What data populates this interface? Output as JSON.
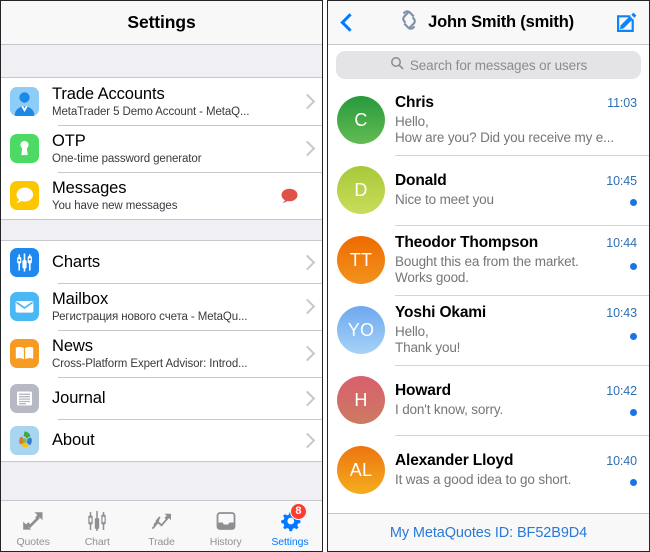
{
  "settings_panel": {
    "nav": {
      "title": "Settings"
    },
    "groups": [
      {
        "items": [
          {
            "icon": "person-account-icon",
            "title": "Trade Accounts",
            "subtitle": "MetaTrader 5 Demo Account - MetaQ...",
            "accessory": "chevron"
          },
          {
            "icon": "keyhole-lock-icon",
            "title": "OTP",
            "subtitle": "One-time password generator",
            "accessory": "chevron"
          },
          {
            "icon": "speech-bubble-icon",
            "title": "Messages",
            "subtitle": "You have new messages",
            "accessory": "message-badge"
          }
        ]
      },
      {
        "items": [
          {
            "icon": "candlestick-chart-icon",
            "title": "Charts",
            "subtitle": "",
            "accessory": "chevron"
          },
          {
            "icon": "envelope-mail-icon",
            "title": "Mailbox",
            "subtitle": "Регистрация нового счета - MetaQu...",
            "accessory": "chevron"
          },
          {
            "icon": "open-book-news-icon",
            "title": "News",
            "subtitle": "Cross-Platform Expert Advisor: Introd...",
            "accessory": "chevron"
          },
          {
            "icon": "journal-lines-icon",
            "title": "Journal",
            "subtitle": "",
            "accessory": "chevron"
          },
          {
            "icon": "metaquotes-about-icon",
            "title": "About",
            "subtitle": "",
            "accessory": "chevron"
          }
        ]
      }
    ],
    "tab_bar": {
      "active_index": 4,
      "tabs": [
        {
          "icon": "quotes-arrows-icon",
          "label": "Quotes",
          "badge": ""
        },
        {
          "icon": "candlestick-icon",
          "label": "Chart",
          "badge": ""
        },
        {
          "icon": "trade-trend-icon",
          "label": "Trade",
          "badge": ""
        },
        {
          "icon": "history-tray-icon",
          "label": "History",
          "badge": ""
        },
        {
          "icon": "gear-settings-icon",
          "label": "Settings",
          "badge": "8"
        }
      ]
    }
  },
  "chat_panel": {
    "nav": {
      "back_icon": "back-chevron-icon",
      "logo_icon": "metaquotes-logo-icon",
      "title": "John Smith (smith)",
      "compose_icon": "compose-pencil-icon"
    },
    "search": {
      "icon": "search-icon",
      "placeholder": "Search for messages or users",
      "value": ""
    },
    "conversations": [
      {
        "initials": "C",
        "avatar_from": "#279a3c",
        "avatar_to": "#63bb52",
        "name": "Chris",
        "time": "11:03",
        "lines": [
          "Hello,",
          "How are you? Did you receive my e..."
        ],
        "unread": false
      },
      {
        "initials": "D",
        "avatar_from": "#a8c93a",
        "avatar_to": "#c4d84f",
        "name": "Donald",
        "time": "10:45",
        "lines": [
          "Nice to meet you"
        ],
        "unread": true
      },
      {
        "initials": "TT",
        "avatar_from": "#f07000",
        "avatar_to": "#ef8a1a",
        "name": "Theodor Thompson",
        "time": "10:44",
        "lines": [
          "Bought this ea from the market.",
          "Works good."
        ],
        "unread": true
      },
      {
        "initials": "YO",
        "avatar_from": "#6ea8ef",
        "avatar_to": "#9fcdf5",
        "name": "Yoshi Okami",
        "time": "10:43",
        "lines": [
          "Hello,",
          "Thank you!"
        ],
        "unread": true
      },
      {
        "initials": "H",
        "avatar_from": "#d8606e",
        "avatar_to": "#cf7168",
        "name": "Howard",
        "time": "10:42",
        "lines": [
          "I don't know, sorry."
        ],
        "unread": true
      },
      {
        "initials": "AL",
        "avatar_from": "#ef7d12",
        "avatar_to": "#f2a41c",
        "name": "Alexander Lloyd",
        "time": "10:40",
        "lines": [
          "It was a good idea to go short."
        ],
        "unread": true
      }
    ],
    "footer": {
      "link_label": "My MetaQuotes ID: BF52B9D4"
    }
  },
  "colors": {
    "accent_blue": "#007aff",
    "badge_red": "#ff3b30",
    "unread_blue": "#1a73e8",
    "time_blue": "#2e6fb0",
    "group_bg": "#efeff4"
  }
}
